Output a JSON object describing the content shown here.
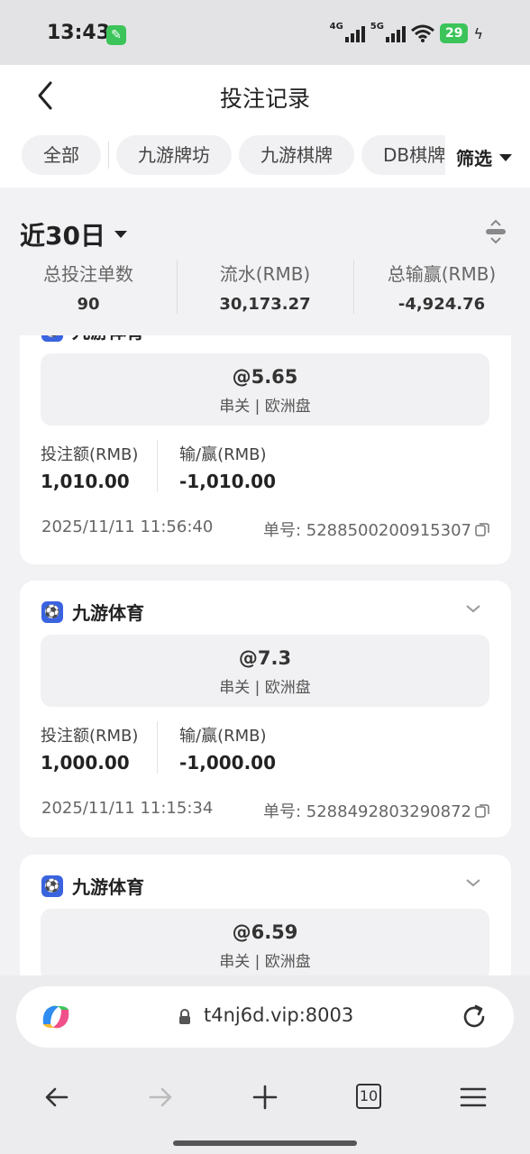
{
  "status_bar": {
    "time": "13:43",
    "net1": "4G",
    "net2": "5G",
    "battery": "29",
    "app_icon": "wrench-icon"
  },
  "header": {
    "title": "投注记录",
    "tabs": [
      "全部",
      "九游牌坊",
      "九游棋牌",
      "DB棋牌"
    ],
    "filter_label": "筛选"
  },
  "summary": {
    "range_label": "近30日",
    "stats": [
      {
        "label": "总投注单数",
        "value": "90"
      },
      {
        "label": "流水(RMB)",
        "value": "30,173.27"
      },
      {
        "label": "总输赢(RMB)",
        "value": "-4,924.76"
      }
    ]
  },
  "records": [
    {
      "platform": "九游体育",
      "odds": "@5.65",
      "bet_type": "串关 | 欧洲盘",
      "stake_label": "投注额(RMB)",
      "stake": "1,010.00",
      "result_label": "输/赢(RMB)",
      "result": "-1,010.00",
      "time": "2025/11/11 11:56:40",
      "order": "单号: 5288500200915307"
    },
    {
      "platform": "九游体育",
      "odds": "@7.3",
      "bet_type": "串关 | 欧洲盘",
      "stake_label": "投注额(RMB)",
      "stake": "1,000.00",
      "result_label": "输/赢(RMB)",
      "result": "-1,000.00",
      "time": "2025/11/11 11:15:34",
      "order": "单号: 5288492803290872"
    },
    {
      "platform": "九游体育",
      "odds": "@6.59",
      "bet_type": "串关 | 欧洲盘"
    }
  ],
  "browser": {
    "url": "t4nj6d.vip:8003",
    "tab_count": "10"
  }
}
